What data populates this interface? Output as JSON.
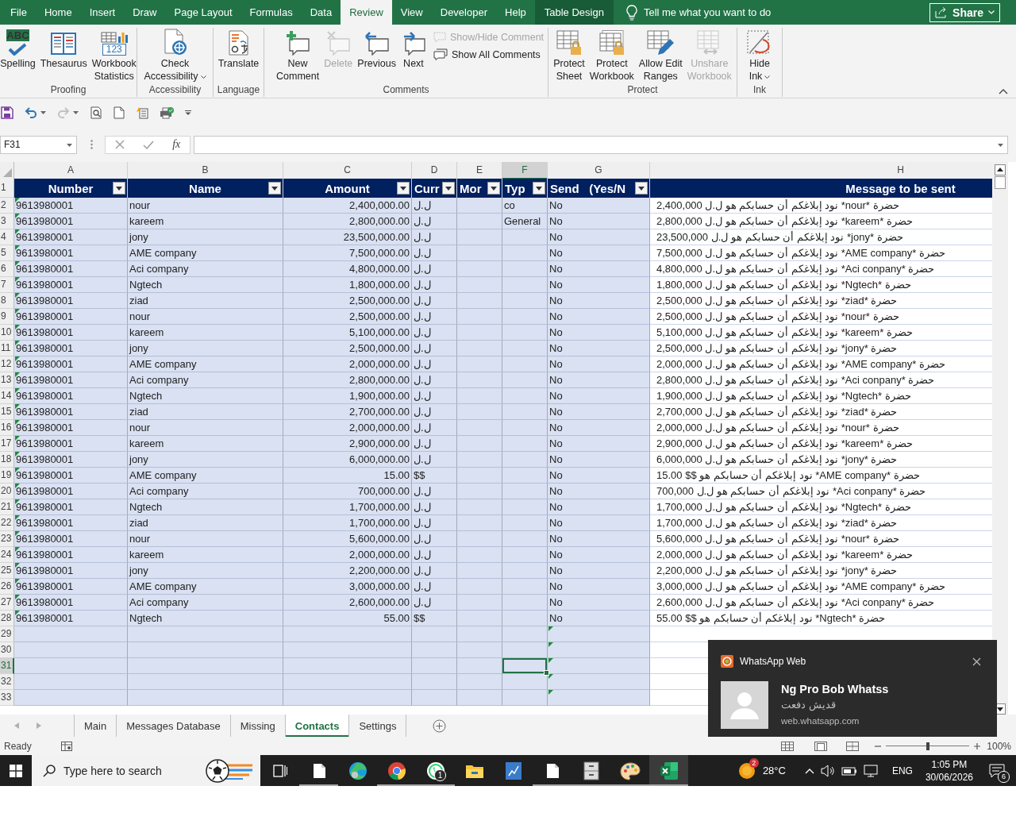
{
  "ribbon_tabs": [
    {
      "label": "File",
      "kind": "standard",
      "selected": false
    },
    {
      "label": "Home",
      "kind": "standard",
      "selected": false
    },
    {
      "label": "Insert",
      "kind": "standard",
      "selected": false
    },
    {
      "label": "Draw",
      "kind": "standard",
      "selected": false
    },
    {
      "label": "Page Layout",
      "kind": "standard",
      "selected": false
    },
    {
      "label": "Formulas",
      "kind": "standard",
      "selected": false
    },
    {
      "label": "Data",
      "kind": "standard",
      "selected": false
    },
    {
      "label": "Review",
      "kind": "standard",
      "selected": true
    },
    {
      "label": "View",
      "kind": "standard",
      "selected": false
    },
    {
      "label": "Developer",
      "kind": "standard",
      "selected": false
    },
    {
      "label": "Help",
      "kind": "standard",
      "selected": false
    },
    {
      "label": "Table Design",
      "kind": "contextual",
      "selected": false
    }
  ],
  "tell_me": {
    "placeholder": "Tell me what you want to do"
  },
  "share_button": {
    "label": "Share"
  },
  "ribbon_groups": [
    {
      "label": "Proofing",
      "buttons": [
        {
          "kind": "large",
          "lines": [
            "Spelling"
          ],
          "icon_text": "ABC",
          "disabled": false,
          "dropdown": false
        },
        {
          "kind": "large",
          "lines": [
            "Thesaurus"
          ],
          "disabled": false,
          "dropdown": false
        },
        {
          "kind": "large",
          "lines": [
            "Workbook",
            "Statistics"
          ],
          "icon_text": "123",
          "disabled": false,
          "dropdown": false
        }
      ]
    },
    {
      "label": "Accessibility",
      "buttons": [
        {
          "kind": "large",
          "lines": [
            "Check",
            "Accessibility"
          ],
          "disabled": false,
          "dropdown": true
        }
      ]
    },
    {
      "label": "Language",
      "buttons": [
        {
          "kind": "large",
          "lines": [
            "Translate"
          ],
          "disabled": false,
          "dropdown": false
        }
      ]
    },
    {
      "label": "Comments",
      "buttons": [
        {
          "kind": "large",
          "lines": [
            "New",
            "Comment"
          ],
          "disabled": false,
          "dropdown": false
        },
        {
          "kind": "large",
          "lines": [
            "Delete"
          ],
          "disabled": true,
          "dropdown": false
        },
        {
          "kind": "large",
          "lines": [
            "Previous"
          ],
          "disabled": false,
          "dropdown": false
        },
        {
          "kind": "large",
          "lines": [
            "Next"
          ],
          "disabled": false,
          "dropdown": false
        },
        {
          "kind": "small",
          "lines": [
            "Show/Hide Comment"
          ],
          "disabled": true,
          "dropdown": false
        },
        {
          "kind": "small",
          "lines": [
            "Show All Comments"
          ],
          "disabled": false,
          "dropdown": false
        }
      ]
    },
    {
      "label": "Protect",
      "buttons": [
        {
          "kind": "large",
          "lines": [
            "Protect",
            "Sheet"
          ],
          "disabled": false,
          "dropdown": false
        },
        {
          "kind": "large",
          "lines": [
            "Protect",
            "Workbook"
          ],
          "disabled": false,
          "dropdown": false
        },
        {
          "kind": "large",
          "lines": [
            "Allow Edit",
            "Ranges"
          ],
          "disabled": false,
          "dropdown": false
        },
        {
          "kind": "large",
          "lines": [
            "Unshare",
            "Workbook"
          ],
          "disabled": true,
          "dropdown": false
        }
      ]
    },
    {
      "label": "Ink",
      "buttons": [
        {
          "kind": "large",
          "lines": [
            "Hide",
            "Ink"
          ],
          "disabled": false,
          "dropdown": true
        }
      ]
    }
  ],
  "quick_access": [
    {
      "disabled": false,
      "dropdown": false
    },
    {
      "disabled": false,
      "dropdown": true
    },
    {
      "disabled": true,
      "dropdown": true
    },
    {
      "disabled": false,
      "dropdown": false
    },
    {
      "disabled": false,
      "dropdown": false
    },
    {
      "disabled": false,
      "dropdown": false
    },
    {
      "disabled": false,
      "dropdown": false
    }
  ],
  "formula_bar": {
    "name_box": "F31",
    "function_label": "fx"
  },
  "sheet": {
    "columns": [
      {
        "letter": "A",
        "selected": false
      },
      {
        "letter": "B",
        "selected": false
      },
      {
        "letter": "C",
        "selected": false
      },
      {
        "letter": "D",
        "selected": false
      },
      {
        "letter": "E",
        "selected": false
      },
      {
        "letter": "F",
        "selected": true
      },
      {
        "letter": "G",
        "selected": false
      },
      {
        "letter": "H",
        "selected": false
      }
    ],
    "header_row": "1",
    "header": [
      {
        "label": "Number",
        "filter": true
      },
      {
        "label": "Name",
        "filter": true
      },
      {
        "label": "Amount",
        "filter": true
      },
      {
        "label": "Curr",
        "filter": true
      },
      {
        "label": "Mor",
        "filter": true
      },
      {
        "label": "Typ",
        "filter": true
      },
      {
        "label": "Send   (Yes/N",
        "filter": true
      },
      {
        "label": "Message to be sent",
        "filter": false
      }
    ],
    "rows": [
      {
        "row": "2",
        "number": "9613980001",
        "name": "nour",
        "amount": "2,400,000.00",
        "currency": "ل.ل",
        "type": "co",
        "send": "No",
        "message": "حضرة *nour* نود إبلاغكم أن حسابكم هو ل.ل 2,400,000",
        "flagged": true
      },
      {
        "row": "3",
        "number": "9613980001",
        "name": "kareem",
        "amount": "2,800,000.00",
        "currency": "ل.ل",
        "type": "General",
        "send": "No",
        "message": "حضرة *kareem* نود إبلاغكم أن حسابكم هو ل.ل 2,800,000",
        "flagged": true
      },
      {
        "row": "4",
        "number": "9613980001",
        "name": "jony",
        "amount": "23,500,000.00",
        "currency": "ل.ل",
        "send": "No",
        "message": "حضرة *jony* نود إبلاغكم أن حسابكم هو ل.ل 23,500,000",
        "flagged": true
      },
      {
        "row": "5",
        "number": "9613980001",
        "name": "AME company",
        "amount": "7,500,000.00",
        "currency": "ل.ل",
        "send": "No",
        "message": "حضرة *AME company* نود إبلاغكم أن حسابكم هو ل.ل 7,500,000",
        "flagged": true
      },
      {
        "row": "6",
        "number": "9613980001",
        "name": "Aci company",
        "amount": "4,800,000.00",
        "currency": "ل.ل",
        "send": "No",
        "message": "حضرة *Aci conpany* نود إبلاغكم أن حسابكم هو ل.ل 4,800,000",
        "flagged": true
      },
      {
        "row": "7",
        "number": "9613980001",
        "name": "Ngtech",
        "amount": "1,800,000.00",
        "currency": "ل.ل",
        "send": "No",
        "message": "حضرة *Ngtech* نود إبلاغكم أن حسابكم هو ل.ل 1,800,000",
        "flagged": true
      },
      {
        "row": "8",
        "number": "9613980001",
        "name": "ziad",
        "amount": "2,500,000.00",
        "currency": "ل.ل",
        "send": "No",
        "message": "حضرة *ziad* نود إبلاغكم أن حسابكم هو ل.ل 2,500,000",
        "flagged": true
      },
      {
        "row": "9",
        "number": "9613980001",
        "name": "nour",
        "amount": "2,500,000.00",
        "currency": "ل.ل",
        "send": "No",
        "message": "حضرة *nour* نود إبلاغكم أن حسابكم هو ل.ل 2,500,000",
        "flagged": true
      },
      {
        "row": "10",
        "number": "9613980001",
        "name": "kareem",
        "amount": "5,100,000.00",
        "currency": "ل.ل",
        "send": "No",
        "message": "حضرة *kareem* نود إبلاغكم أن حسابكم هو ل.ل 5,100,000",
        "flagged": true
      },
      {
        "row": "11",
        "number": "9613980001",
        "name": "jony",
        "amount": "2,500,000.00",
        "currency": "ل.ل",
        "send": "No",
        "message": "حضرة *jony* نود إبلاغكم أن حسابكم هو ل.ل 2,500,000",
        "flagged": true
      },
      {
        "row": "12",
        "number": "9613980001",
        "name": "AME company",
        "amount": "2,000,000.00",
        "currency": "ل.ل",
        "send": "No",
        "message": "حضرة *AME company* نود إبلاغكم أن حسابكم هو ل.ل 2,000,000",
        "flagged": true
      },
      {
        "row": "13",
        "number": "9613980001",
        "name": "Aci company",
        "amount": "2,800,000.00",
        "currency": "ل.ل",
        "send": "No",
        "message": "حضرة *Aci conpany* نود إبلاغكم أن حسابكم هو ل.ل 2,800,000",
        "flagged": true
      },
      {
        "row": "14",
        "number": "9613980001",
        "name": "Ngtech",
        "amount": "1,900,000.00",
        "currency": "ل.ل",
        "send": "No",
        "message": "حضرة *Ngtech* نود إبلاغكم أن حسابكم هو ل.ل 1,900,000",
        "flagged": true
      },
      {
        "row": "15",
        "number": "9613980001",
        "name": "ziad",
        "amount": "2,700,000.00",
        "currency": "ل.ل",
        "send": "No",
        "message": "حضرة *ziad* نود إبلاغكم أن حسابكم هو ل.ل 2,700,000",
        "flagged": true
      },
      {
        "row": "16",
        "number": "9613980001",
        "name": "nour",
        "amount": "2,000,000.00",
        "currency": "ل.ل",
        "send": "No",
        "message": "حضرة *nour* نود إبلاغكم أن حسابكم هو ل.ل 2,000,000",
        "flagged": true
      },
      {
        "row": "17",
        "number": "9613980001",
        "name": "kareem",
        "amount": "2,900,000.00",
        "currency": "ل.ل",
        "send": "No",
        "message": "حضرة *kareem* نود إبلاغكم أن حسابكم هو ل.ل 2,900,000",
        "flagged": true
      },
      {
        "row": "18",
        "number": "9613980001",
        "name": "jony",
        "amount": "6,000,000.00",
        "currency": "ل.ل",
        "send": "No",
        "message": "حضرة *jony* نود إبلاغكم أن حسابكم هو ل.ل 6,000,000",
        "flagged": true
      },
      {
        "row": "19",
        "number": "9613980001",
        "name": "AME company",
        "amount": "15.00",
        "currency": "$$",
        "send": "No",
        "message": "حضرة *AME company* نود إبلاغكم أن حسابكم هو $$ 15.00",
        "flagged": true
      },
      {
        "row": "20",
        "number": "9613980001",
        "name": "Aci company",
        "amount": "700,000.00",
        "currency": "ل.ل",
        "send": "No",
        "message": "حضرة *Aci conpany* نود إبلاغكم أن حسابكم هو ل.ل 700,000",
        "flagged": true
      },
      {
        "row": "21",
        "number": "9613980001",
        "name": "Ngtech",
        "amount": "1,700,000.00",
        "currency": "ل.ل",
        "send": "No",
        "message": "حضرة *Ngtech* نود إبلاغكم أن حسابكم هو ل.ل 1,700,000",
        "flagged": true
      },
      {
        "row": "22",
        "number": "9613980001",
        "name": "ziad",
        "amount": "1,700,000.00",
        "currency": "ل.ل",
        "send": "No",
        "message": "حضرة *ziad* نود إبلاغكم أن حسابكم هو ل.ل 1,700,000",
        "flagged": true
      },
      {
        "row": "23",
        "number": "9613980001",
        "name": "nour",
        "amount": "5,600,000.00",
        "currency": "ل.ل",
        "send": "No",
        "message": "حضرة *nour* نود إبلاغكم أن حسابكم هو ل.ل 5,600,000",
        "flagged": true
      },
      {
        "row": "24",
        "number": "9613980001",
        "name": "kareem",
        "amount": "2,000,000.00",
        "currency": "ل.ل",
        "send": "No",
        "message": "حضرة *kareem* نود إبلاغكم أن حسابكم هو ل.ل 2,000,000",
        "flagged": true
      },
      {
        "row": "25",
        "number": "9613980001",
        "name": "jony",
        "amount": "2,200,000.00",
        "currency": "ل.ل",
        "send": "No",
        "message": "حضرة *jony* نود إبلاغكم أن حسابكم هو ل.ل 2,200,000",
        "flagged": true
      },
      {
        "row": "26",
        "number": "9613980001",
        "name": "AME company",
        "amount": "3,000,000.00",
        "currency": "ل.ل",
        "send": "No",
        "message": "حضرة *AME company* نود إبلاغكم أن حسابكم هو ل.ل 3,000,000",
        "flagged": true
      },
      {
        "row": "27",
        "number": "9613980001",
        "name": "Aci company",
        "amount": "2,600,000.00",
        "currency": "ل.ل",
        "send": "No",
        "message": "حضرة *Aci conpany* نود إبلاغكم أن حسابكم هو ل.ل 2,600,000",
        "flagged": true
      },
      {
        "row": "28",
        "number": "9613980001",
        "name": "Ngtech",
        "amount": "55.00",
        "currency": "$$",
        "send": "No",
        "message": "حضرة *Ngtech* نود إبلاغكم أن حسابكم هو $$ 55.00",
        "flagged": true
      }
    ],
    "empty_rows": [
      {
        "row": "29",
        "selected": false,
        "flagged": true
      },
      {
        "row": "30",
        "selected": false,
        "flagged": true
      },
      {
        "row": "31",
        "selected": true,
        "flagged": true
      },
      {
        "row": "32",
        "selected": false,
        "flagged": true
      },
      {
        "row": "33",
        "selected": false,
        "flagged": true
      }
    ]
  },
  "sheet_tabs": [
    {
      "label": "Main",
      "selected": false
    },
    {
      "label": "Messages Database",
      "selected": false
    },
    {
      "label": "Missing",
      "selected": false
    },
    {
      "label": "Contacts",
      "selected": true
    },
    {
      "label": "Settings",
      "selected": false
    }
  ],
  "status_bar": {
    "text": "Ready",
    "zoom_slider": {
      "level": 0.5
    },
    "zoom": "100%"
  },
  "taskbar": {
    "search": {
      "placeholder": "Type here to search"
    },
    "apps": [
      {
        "selected": false,
        "running": true
      },
      {
        "selected": false,
        "running": false
      },
      {
        "selected": false,
        "running": true
      },
      {
        "selected": false,
        "running": true,
        "badge": "1"
      },
      {
        "selected": false,
        "running": false
      },
      {
        "selected": false,
        "running": false
      },
      {
        "selected": false,
        "running": true
      },
      {
        "selected": false,
        "running": true
      },
      {
        "selected": false,
        "running": true
      },
      {
        "selected": true,
        "running": true
      }
    ],
    "weather": {
      "badge": "2",
      "temperature": "28°C"
    },
    "language": "ENG",
    "time": "1:05 PM",
    "date": "30/06/2026",
    "notification_badge": "6"
  },
  "notification": {
    "app": "WhatsApp Web",
    "title": "Ng Pro Bob Whatss",
    "body": "قديش دفعت",
    "source": "web.whatsapp.com"
  }
}
